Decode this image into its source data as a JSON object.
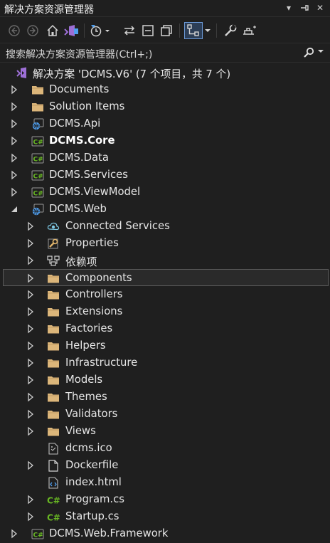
{
  "window": {
    "title": "解决方案资源管理器",
    "ctrl_dropdown": "▾",
    "ctrl_pin": "⊣",
    "ctrl_close": "✕"
  },
  "toolbar": {
    "buttons": [
      "back",
      "forward",
      "home",
      "vs-switch",
      "pending-changes",
      "sync",
      "collapse-all",
      "show-all-files",
      "preview-selected",
      "properties",
      "settings"
    ]
  },
  "search": {
    "placeholder": "搜索解决方案资源管理器(Ctrl+;)"
  },
  "tree": {
    "solution": "解决方案 'DCMS.V6' (7 个项目，共 7 个)",
    "items": [
      {
        "label": "Documents",
        "icon": "folder-icon",
        "expand": "collapsed",
        "level": 1
      },
      {
        "label": "Solution Items",
        "icon": "folder-icon",
        "expand": "collapsed",
        "level": 1
      },
      {
        "label": "DCMS.Api",
        "icon": "web-project-icon",
        "expand": "collapsed",
        "level": 1
      },
      {
        "label": "DCMS.Core",
        "icon": "csharp-project-icon",
        "expand": "collapsed",
        "level": 1,
        "bold": true
      },
      {
        "label": "DCMS.Data",
        "icon": "csharp-project-icon",
        "expand": "collapsed",
        "level": 1
      },
      {
        "label": "DCMS.Services",
        "icon": "csharp-project-icon",
        "expand": "collapsed",
        "level": 1
      },
      {
        "label": "DCMS.ViewModel",
        "icon": "csharp-project-icon",
        "expand": "collapsed",
        "level": 1
      },
      {
        "label": "DCMS.Web",
        "icon": "web-project-icon",
        "expand": "expanded",
        "level": 1
      },
      {
        "label": "Connected Services",
        "icon": "connected-services-icon",
        "expand": "collapsed",
        "level": 2
      },
      {
        "label": "Properties",
        "icon": "properties-icon",
        "expand": "collapsed",
        "level": 2
      },
      {
        "label": "依赖项",
        "icon": "dependencies-icon",
        "expand": "collapsed",
        "level": 2
      },
      {
        "label": "Components",
        "icon": "folder-icon",
        "expand": "collapsed",
        "level": 2,
        "selected": true
      },
      {
        "label": "Controllers",
        "icon": "folder-icon",
        "expand": "collapsed",
        "level": 2
      },
      {
        "label": "Extensions",
        "icon": "folder-icon",
        "expand": "collapsed",
        "level": 2
      },
      {
        "label": "Factories",
        "icon": "folder-icon",
        "expand": "collapsed",
        "level": 2
      },
      {
        "label": "Helpers",
        "icon": "folder-icon",
        "expand": "collapsed",
        "level": 2
      },
      {
        "label": "Infrastructure",
        "icon": "folder-icon",
        "expand": "collapsed",
        "level": 2
      },
      {
        "label": "Models",
        "icon": "folder-icon",
        "expand": "collapsed",
        "level": 2
      },
      {
        "label": "Themes",
        "icon": "folder-icon",
        "expand": "collapsed",
        "level": 2
      },
      {
        "label": "Validators",
        "icon": "folder-icon",
        "expand": "collapsed",
        "level": 2
      },
      {
        "label": "Views",
        "icon": "folder-icon",
        "expand": "collapsed",
        "level": 2
      },
      {
        "label": "dcms.ico",
        "icon": "ico-file-icon",
        "expand": "none",
        "level": 2
      },
      {
        "label": "Dockerfile",
        "icon": "file-icon",
        "expand": "collapsed",
        "level": 2
      },
      {
        "label": "index.html",
        "icon": "html-file-icon",
        "expand": "none",
        "level": 2
      },
      {
        "label": "Program.cs",
        "icon": "csharp-file-icon",
        "expand": "collapsed",
        "level": 2
      },
      {
        "label": "Startup.cs",
        "icon": "csharp-file-icon",
        "expand": "collapsed",
        "level": 2
      },
      {
        "label": "DCMS.Web.Framework",
        "icon": "csharp-project-icon",
        "expand": "collapsed",
        "level": 1
      }
    ]
  },
  "colors": {
    "background": "#1f1f1f",
    "folder": "#dcb67a",
    "csharp": "#68b723",
    "vs_purple": "#9d6fd6",
    "web_blue": "#4f9ff0",
    "selection_border": "#5a5a5a"
  }
}
